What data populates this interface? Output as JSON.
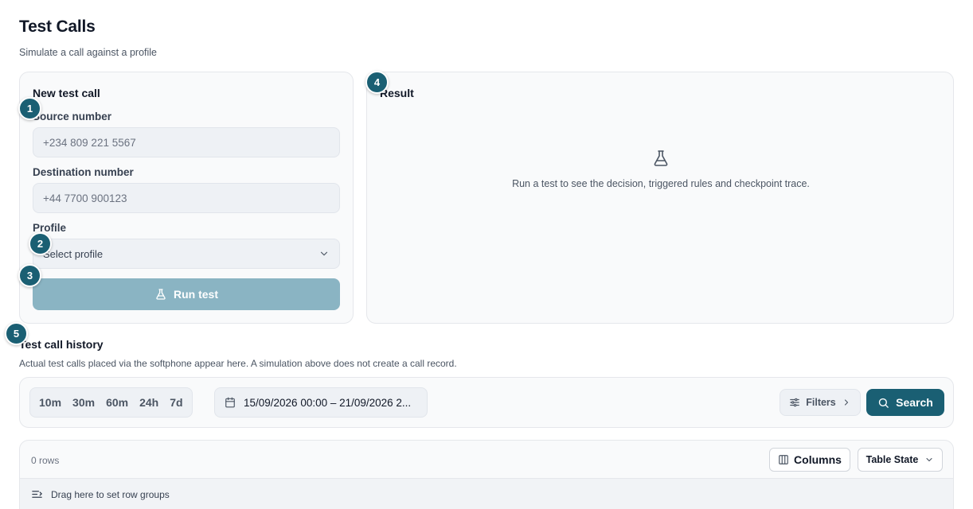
{
  "page": {
    "title": "Test Calls",
    "subtitle": "Simulate a call against a profile"
  },
  "form": {
    "title": "New test call",
    "source_label": "Source number",
    "source_placeholder": "+234 809 221 5567",
    "destination_label": "Destination number",
    "destination_placeholder": "+44 7700 900123",
    "profile_label": "Profile",
    "profile_value": "Select profile",
    "run_label": "Run test"
  },
  "result": {
    "title": "Result",
    "empty_text": "Run a test to see the decision, triggered rules and checkpoint trace.",
    "icon": "flask-icon"
  },
  "badges": [
    "1",
    "2",
    "3",
    "4",
    "5"
  ],
  "history": {
    "title": "Test call history",
    "subtitle": "Actual test calls placed via the softphone appear here. A simulation above does not create a call record.",
    "ranges": [
      "10m",
      "30m",
      "60m",
      "24h",
      "7d"
    ],
    "date_range": "15/09/2026 00:00 – 21/09/2026 2...",
    "filters_label": "Filters",
    "search_label": "Search"
  },
  "table": {
    "row_count": "0 rows",
    "columns_label": "Columns",
    "table_state_label": "Table State",
    "group_hint": "Drag here to set row groups"
  },
  "colors": {
    "accent": "#1a5f73",
    "accent_disabled": "#8ab4c3"
  }
}
